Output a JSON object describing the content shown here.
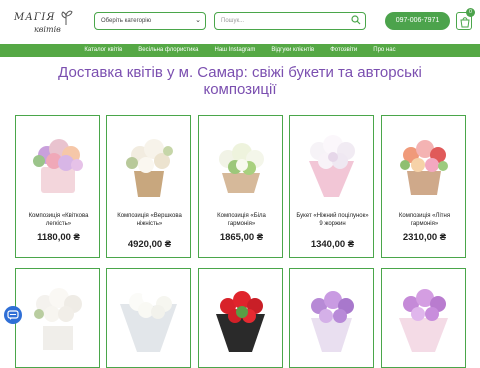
{
  "header": {
    "logo_line1": "МАГІЯ",
    "logo_line2": "квітів",
    "category_select": "Оберіть категорію",
    "search_placeholder": "Пошук...",
    "phone": "097-006-7971",
    "cart_count": "0"
  },
  "nav": [
    "Каталог квітів",
    "Весільна флористика",
    "Наш Instagram",
    "Відгуки клієнтів",
    "Фотозвіти",
    "Про нас"
  ],
  "page_title": "Доставка квітів у м. Самар: свіжі букети та авторські композиції",
  "products": [
    {
      "name": "Композиція «Квіткова легкість»",
      "price": "1180,00 ₴"
    },
    {
      "name": "Композиція «Вершкова ніжність»",
      "price": "4920,00 ₴"
    },
    {
      "name": "Композиція «Біла гармонія»",
      "price": "1865,00 ₴"
    },
    {
      "name": "Букет «Ніжний поцілунок» 9 жоржин",
      "price": "1340,00 ₴"
    },
    {
      "name": "Композиція «Літня гармонія»",
      "price": "2310,00 ₴"
    }
  ],
  "colors": {
    "brand_green": "#4ca34c",
    "title_purple": "#7b4fb0"
  }
}
